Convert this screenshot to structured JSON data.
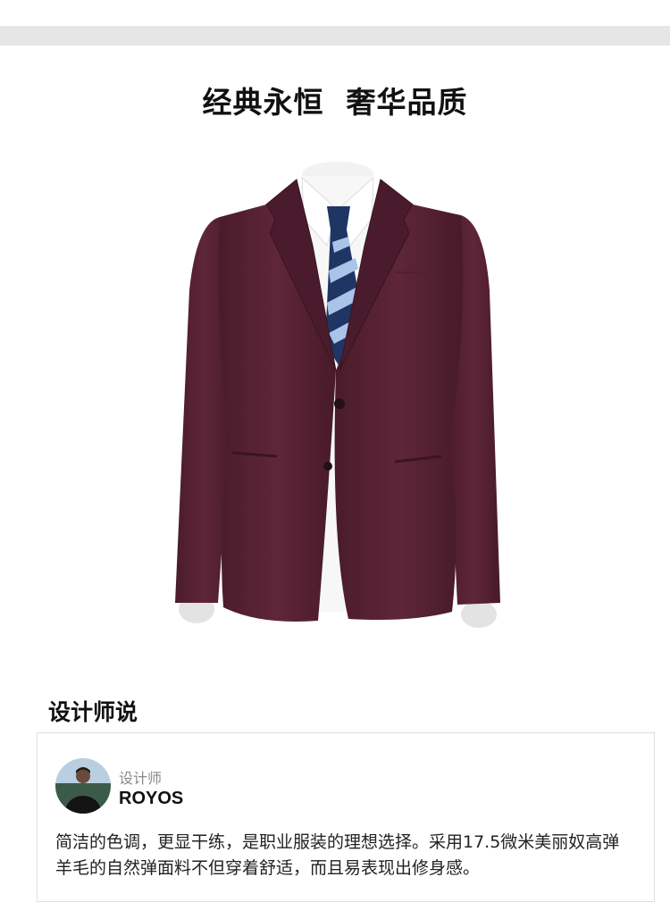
{
  "headline": "经典永恒  奢华品质",
  "product": {
    "image_name": "burgundy-suit-jacket",
    "jacket_color": "#5a2336",
    "tie_colors": [
      "#1f3564",
      "#a9c4e8"
    ]
  },
  "designer_section": {
    "title": "设计师说",
    "role": "设计师",
    "name": "ROYOS",
    "quote": "简洁的色调，更显干练，是职业服装的理想选择。采用17.5微米美丽奴高弹羊毛的自然弹面料不但穿着舒适，而且易表现出修身感。"
  }
}
